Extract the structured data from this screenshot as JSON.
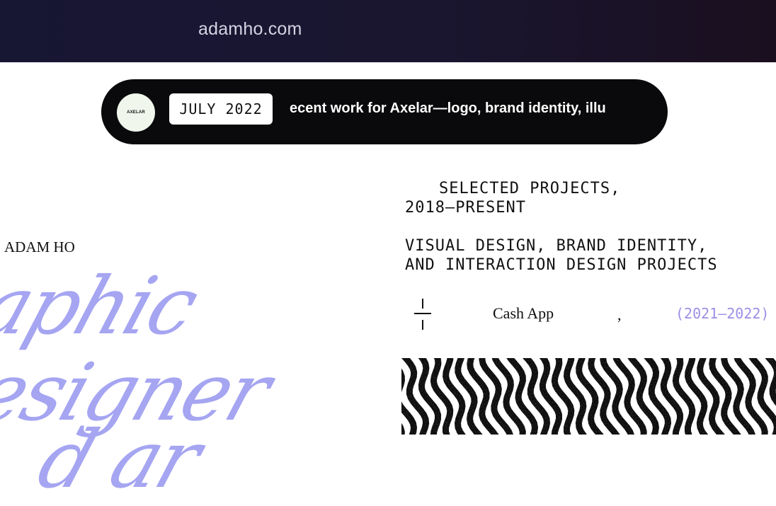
{
  "browser": {
    "url": "adamho.com"
  },
  "ticker": {
    "logo_text": "AXELAR",
    "date": "JULY 2022",
    "text": "ecent work for Axelar—logo, brand identity, illu"
  },
  "profile": {
    "name": "ADAM HO",
    "script_line1": "aphic",
    "script_line2": "esigner",
    "script_line3": "d ar"
  },
  "projects": {
    "heading_line1": "SELECTED PROJECTS,",
    "heading_line2": "2018–PRESENT",
    "desc_line1": "VISUAL DESIGN, BRAND IDENTITY,",
    "desc_line2": "AND INTERACTION DESIGN PROJECTS",
    "item": {
      "name": "Cash App",
      "separator": ",",
      "years": "(2021–2022)"
    }
  },
  "colors": {
    "accent": "#a5a5f2",
    "topbar": "#171633",
    "ticker_bg": "#0a0a0c"
  }
}
